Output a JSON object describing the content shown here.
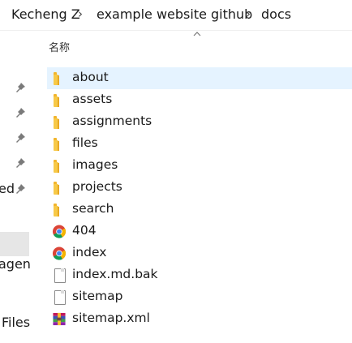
{
  "breadcrumb": {
    "items": [
      "Kecheng Z",
      "example website github",
      "docs"
    ],
    "separator": "›"
  },
  "navpane": {
    "partial_labels": [
      "ed",
      "agen",
      "Files"
    ],
    "pin_count": 5
  },
  "columns": {
    "name_header": "名称",
    "sort": "ascending"
  },
  "files": [
    {
      "name": "about",
      "type": "folder",
      "selected": true
    },
    {
      "name": "assets",
      "type": "folder"
    },
    {
      "name": "assignments",
      "type": "folder"
    },
    {
      "name": "files",
      "type": "folder"
    },
    {
      "name": "images",
      "type": "folder"
    },
    {
      "name": "projects",
      "type": "folder"
    },
    {
      "name": "search",
      "type": "folder"
    },
    {
      "name": "404",
      "type": "chrome-html"
    },
    {
      "name": "index",
      "type": "chrome-html"
    },
    {
      "name": "index.md.bak",
      "type": "file"
    },
    {
      "name": "sitemap",
      "type": "file"
    },
    {
      "name": "sitemap.xml",
      "type": "archive"
    }
  ],
  "colors": {
    "selection": "#e5f3ff",
    "nav_selection": "#e6e6e6",
    "folder": "#f7c948"
  }
}
